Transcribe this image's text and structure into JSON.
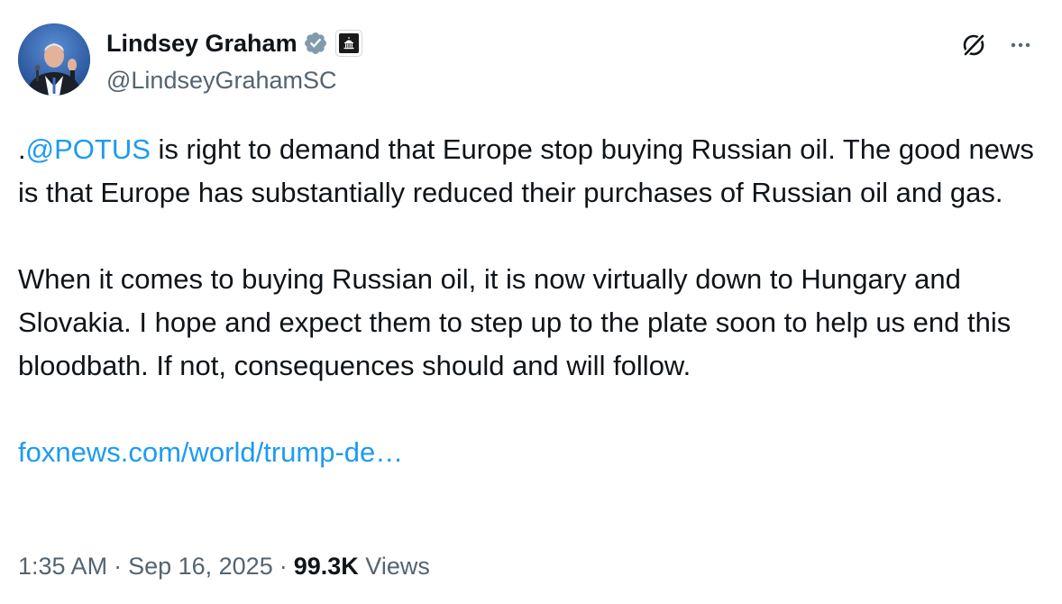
{
  "author": {
    "display_name": "Lindsey Graham",
    "handle": "@LindseyGrahamSC",
    "verified_icon": "verified-badge-icon",
    "affiliation_icon": "government-capitol-icon"
  },
  "tweet": {
    "para1_lead": ".",
    "para1_mention": "@POTUS",
    "para1_rest": " is right to demand that Europe stop buying Russian oil. The good news is that Europe has substantially reduced their purchases of Russian oil and gas.",
    "para2": "When it comes to buying Russian oil, it is now virtually down to Hungary and Slovakia. I hope and expect them to step up to the plate soon to help us end this bloodbath. If not, consequences should and will follow.",
    "link_text": "foxnews.com/world/trump-de…"
  },
  "meta": {
    "time": "1:35 AM",
    "separator": "·",
    "date": "Sep 16, 2025",
    "views_count": "99.3K",
    "views_label": "Views"
  },
  "colors": {
    "link": "#1d9bf0",
    "text": "#0f1419",
    "secondary": "#536471",
    "verified_badge": "#829aab"
  }
}
